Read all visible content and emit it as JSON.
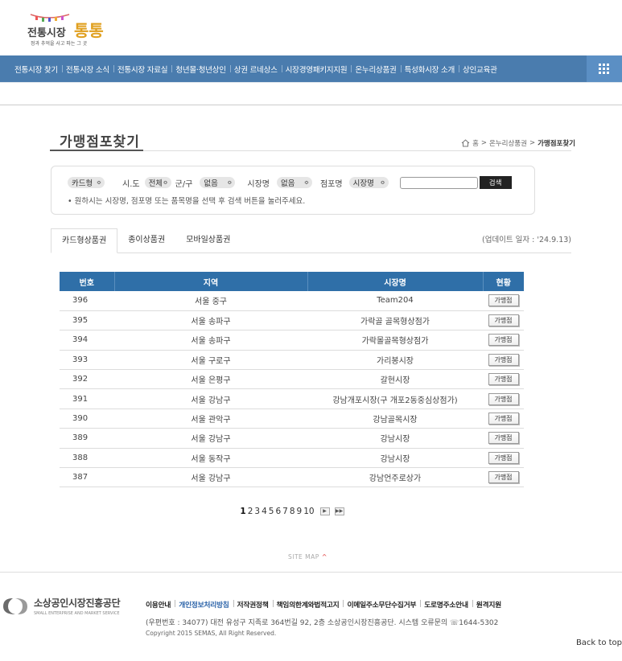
{
  "header": {
    "logo_text": "전통시장통통",
    "logo_sub": "정과 추억을 사고 파는 그 곳"
  },
  "nav": {
    "items": [
      "전통시장 찾기",
      "전통시장 소식",
      "전통시장 자료실",
      "청년몰·청년상인",
      "상권 르네상스",
      "시장경영패키지지원",
      "온누리상품권",
      "특성화시장 소개",
      "상인교육관"
    ],
    "menu_icon": "grid-menu-icon"
  },
  "page": {
    "title": "가맹점포찾기",
    "breadcrumb": {
      "home": "홈",
      "sep": ">",
      "section": "온누리상품권",
      "current": "가맹점포찾기"
    }
  },
  "search": {
    "card_type": "카드형",
    "sido_label": "시.도",
    "sido_value": "전체",
    "gungu_label": "군/구",
    "gungu_value": "없음",
    "market_label": "시장명",
    "market_value": "없음",
    "store_label": "점포명",
    "store_select": "시장명",
    "keyword_placeholder": "",
    "button": "검색",
    "note": "• 원하시는 시장명, 점포명 또는 품목명을 선택 후 검색 버튼을 눌러주세요."
  },
  "tabs": {
    "items": [
      "카드형상품권",
      "종이상품권",
      "모바일상품권"
    ],
    "active": 0,
    "update": "(업데이트 일자 : '24.9.13)"
  },
  "table": {
    "headers": [
      "번호",
      "지역",
      "시장명",
      "현황"
    ],
    "button_label": "가맹점",
    "rows": [
      {
        "num": "396",
        "region": "서울 중구",
        "market": "Team204"
      },
      {
        "num": "395",
        "region": "서울 송파구",
        "market": "가락골 골목형상점가"
      },
      {
        "num": "394",
        "region": "서울 송파구",
        "market": "가락몰골목형상점가"
      },
      {
        "num": "393",
        "region": "서울 구로구",
        "market": "가리봉시장"
      },
      {
        "num": "392",
        "region": "서울 은평구",
        "market": "갈현시장"
      },
      {
        "num": "391",
        "region": "서울 강남구",
        "market": "강남개포시장(구 개포2동중심상점가)"
      },
      {
        "num": "390",
        "region": "서울 관악구",
        "market": "강남골목시장"
      },
      {
        "num": "389",
        "region": "서울 강남구",
        "market": "강남시장"
      },
      {
        "num": "388",
        "region": "서울 동작구",
        "market": "강남시장"
      },
      {
        "num": "387",
        "region": "서울 강남구",
        "market": "강남언주로상가"
      }
    ]
  },
  "pagination": {
    "pages": [
      "1",
      "2",
      "3",
      "4",
      "5",
      "6",
      "7",
      "8",
      "9",
      "10"
    ],
    "active": "1",
    "next": "▶",
    "last": "▶▶"
  },
  "sitemap": {
    "label": "SITE MAP",
    "arrow": "^"
  },
  "footer": {
    "org_name": "소상공인시장진흥공단",
    "org_en": "SMALL ENTERPRISE AND MARKET SERVICE",
    "links": [
      "이용안내",
      "개인정보처리방침",
      "저작권정책",
      "책임의한계와법적고지",
      "이메일주소무단수집거부",
      "도로명주소안내",
      "원격지원"
    ],
    "address": "(우편번호 : 34077) 대전 유성구 지족로 364번길 92, 2층 소상공인시장진흥공단.   시스템 오류문의 ☏1644-5302",
    "copyright": "Copyright 2015 SEMAS, All Right Reserved."
  },
  "back_to_top": "Back to top",
  "colors": {
    "nav_bg": "#4a7cae",
    "table_header": "#2f6fa8",
    "link_highlight": "#2a62a8"
  }
}
